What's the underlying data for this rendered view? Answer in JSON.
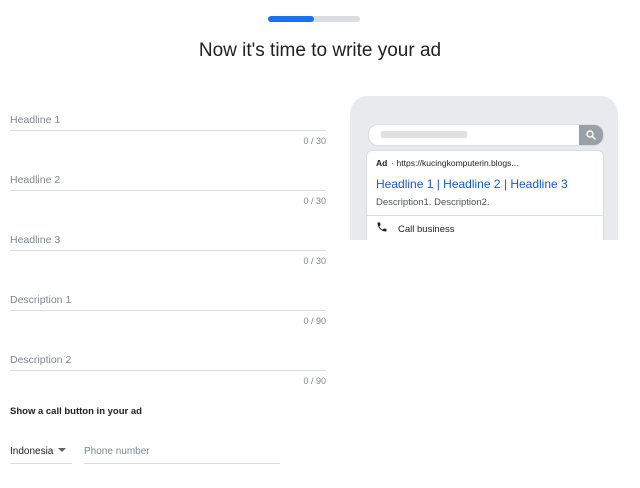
{
  "progress": {
    "fraction": 0.5,
    "accent": "#1a73e8",
    "track": "#dadce0"
  },
  "page_title": "Now it's time to write your ad",
  "fields": [
    {
      "placeholder": "Headline 1",
      "counter": "0 / 30"
    },
    {
      "placeholder": "Headline 2",
      "counter": "0 / 30"
    },
    {
      "placeholder": "Headline 3",
      "counter": "0 / 30"
    },
    {
      "placeholder": "Description 1",
      "counter": "0 / 90"
    },
    {
      "placeholder": "Description 2",
      "counter": "0 / 90"
    }
  ],
  "call": {
    "heading": "Show a call button in your ad",
    "country": "Indonesia",
    "phone_placeholder": "Phone number"
  },
  "preview": {
    "ad_label": "Ad",
    "url": "· https://kucingkomputerin.blogs...",
    "headline": "Headline 1 | Headline 2 | Headline 3",
    "description": "Description1. Description2.",
    "call_label": "Call business",
    "search_icon": "search-icon",
    "phone_icon": "phone-icon",
    "link_color": "#1558d6"
  }
}
